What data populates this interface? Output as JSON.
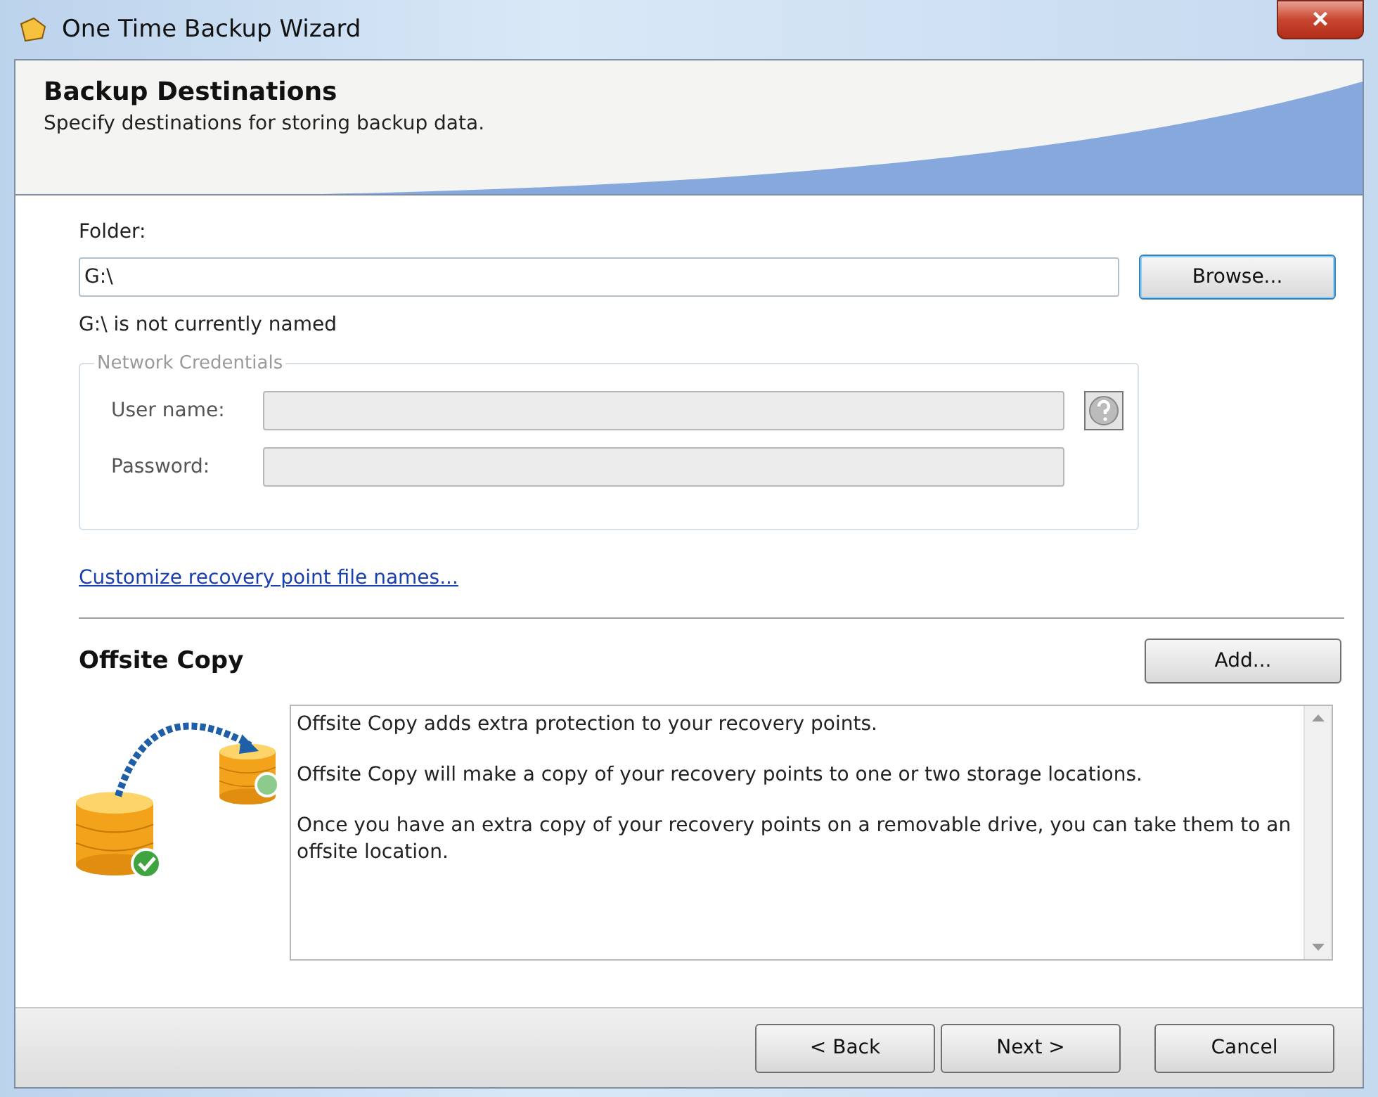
{
  "window": {
    "title": "One Time Backup Wizard",
    "close": "×"
  },
  "header": {
    "title": "Backup Destinations",
    "subtitle": "Specify destinations for storing backup data."
  },
  "folder": {
    "label": "Folder:",
    "value": "G:\\",
    "browse": "Browse...",
    "note": "G:\\ is not currently named"
  },
  "credentials": {
    "legend": "Network Credentials",
    "disabled": true,
    "fields": [
      {
        "label": "User name:",
        "help": true
      },
      {
        "label": "Password:",
        "help": false
      }
    ]
  },
  "link": "Customize recovery point file names...",
  "offsite": {
    "title": "Offsite Copy",
    "add": "Add...",
    "paragraphs": [
      "Offsite Copy adds extra protection to your recovery points.",
      "Offsite Copy will make a copy of your recovery points to one or two storage locations.",
      "Once you have an extra copy of your recovery points on a removable drive, you can take them to an offsite location."
    ]
  },
  "buttons": [
    {
      "label": "< Back",
      "focused": false
    },
    {
      "label": "Next >",
      "focused": false
    },
    {
      "label": "Cancel",
      "focused": false
    }
  ]
}
